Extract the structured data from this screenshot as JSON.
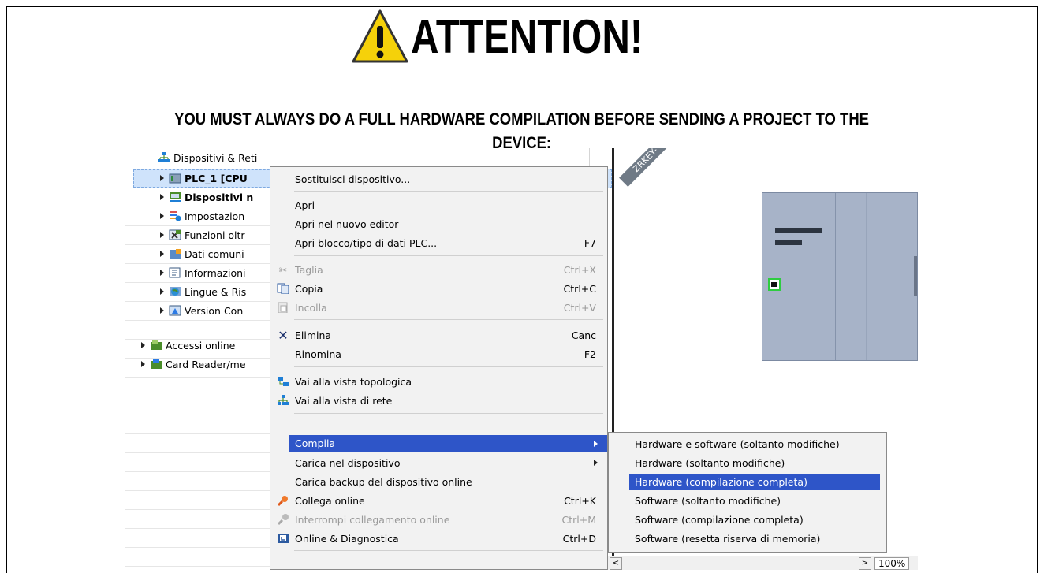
{
  "header": {
    "title": "ATTENTION!",
    "subtitle_line1": "YOU MUST ALWAYS DO A FULL HARDWARE COMPILATION BEFORE SENDING A PROJECT TO THE",
    "subtitle_line2": "DEVICE:"
  },
  "tree": {
    "items": [
      {
        "label": "Dispositivi & Reti",
        "icon": "network-icon"
      },
      {
        "label": "PLC_1 [CPU",
        "icon": "plc-icon"
      },
      {
        "label": "Dispositivi n",
        "icon": "devices-icon"
      },
      {
        "label": "Impostazion",
        "icon": "settings-icon"
      },
      {
        "label": "Funzioni oltr",
        "icon": "functions-icon"
      },
      {
        "label": "Dati comuni",
        "icon": "data-icon"
      },
      {
        "label": "Informazioni",
        "icon": "info-icon"
      },
      {
        "label": "Lingue & Ris",
        "icon": "globe-icon"
      },
      {
        "label": "Version Con",
        "icon": "version-icon"
      },
      {
        "label": "Accessi online",
        "icon": "online-access-icon"
      },
      {
        "label": "Card Reader/me",
        "icon": "card-reader-icon"
      }
    ]
  },
  "device_label": "ZRKEY-",
  "context_menu": {
    "items": [
      {
        "label": "Sostituisci dispositivo...",
        "shortcut": ""
      },
      {
        "label": "Apri",
        "shortcut": ""
      },
      {
        "label": "Apri nel nuovo editor",
        "shortcut": ""
      },
      {
        "label": "Apri blocco/tipo di dati PLC...",
        "shortcut": "F7"
      },
      {
        "label": "Taglia",
        "shortcut": "Ctrl+X"
      },
      {
        "label": "Copia",
        "shortcut": "Ctrl+C"
      },
      {
        "label": "Incolla",
        "shortcut": "Ctrl+V"
      },
      {
        "label": "Elimina",
        "shortcut": "Canc"
      },
      {
        "label": "Rinomina",
        "shortcut": "F2"
      },
      {
        "label": "Vai alla vista topologica",
        "shortcut": ""
      },
      {
        "label": "Vai alla vista di rete",
        "shortcut": ""
      },
      {
        "label": "Compila",
        "shortcut": ""
      },
      {
        "label": "Carica nel dispositivo",
        "shortcut": ""
      },
      {
        "label": "Carica backup del dispositivo online",
        "shortcut": ""
      },
      {
        "label": "Collega online",
        "shortcut": "Ctrl+K"
      },
      {
        "label": "Interrompi collegamento online",
        "shortcut": "Ctrl+M"
      },
      {
        "label": "Online & Diagnostica",
        "shortcut": "Ctrl+D"
      }
    ]
  },
  "submenu": {
    "items": [
      {
        "label": "Hardware e software (soltanto modifiche)"
      },
      {
        "label": "Hardware (soltanto modifiche)"
      },
      {
        "label": "Hardware (compilazione completa)"
      },
      {
        "label": "Software (soltanto modifiche)"
      },
      {
        "label": "Software (compilazione completa)"
      },
      {
        "label": "Software (resetta riserva di memoria)"
      }
    ]
  },
  "zoom": "100%",
  "colors": {
    "highlight": "#2e55c8",
    "selection": "#cfe3fb",
    "warning": "#f5d10a"
  }
}
